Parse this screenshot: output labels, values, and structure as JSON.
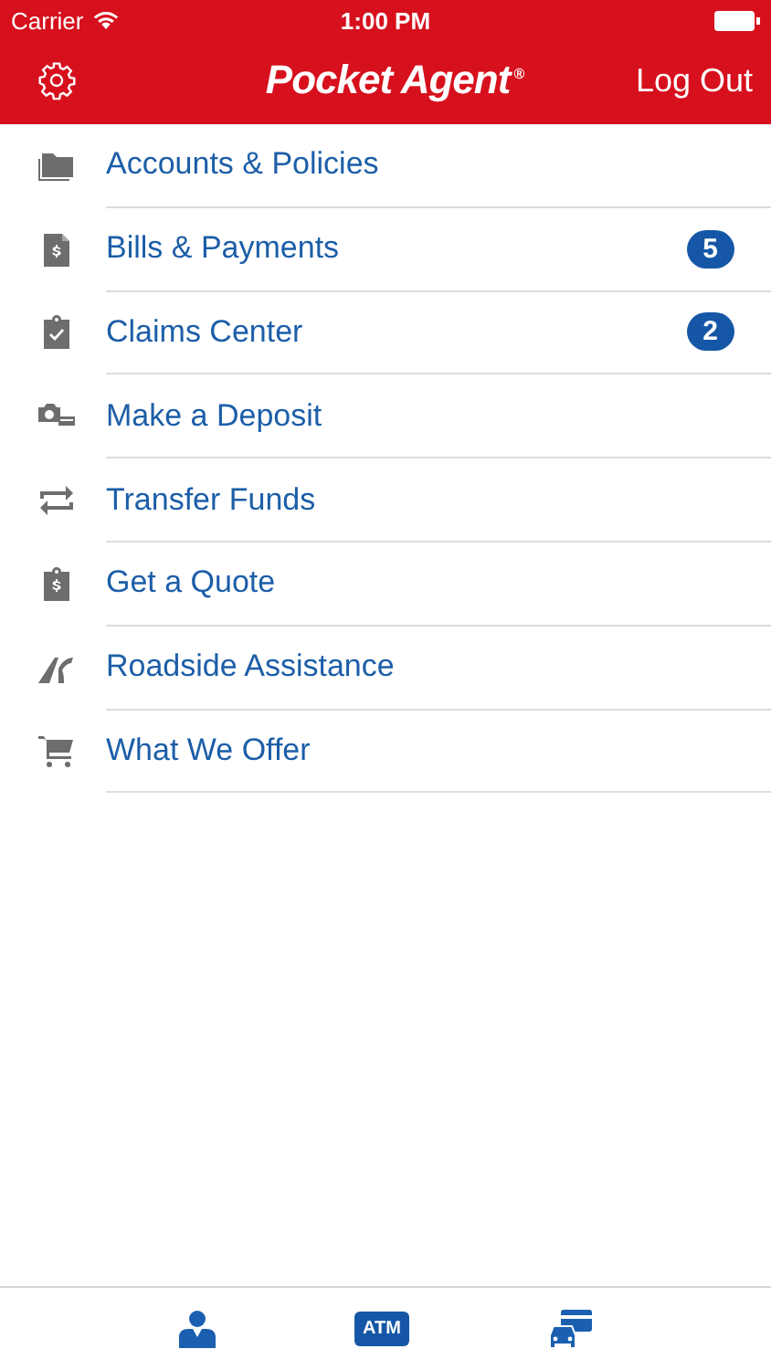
{
  "status_bar": {
    "carrier": "Carrier",
    "time": "1:00 PM"
  },
  "nav_bar": {
    "title": "Pocket Agent",
    "title_mark": "®",
    "right_button": "Log Out"
  },
  "menu": [
    {
      "kind": "folder",
      "label": "Accounts & Policies"
    },
    {
      "kind": "bill",
      "label": "Bills & Payments",
      "badge": "5"
    },
    {
      "kind": "claim",
      "label": "Claims Center",
      "badge": "2"
    },
    {
      "kind": "camera",
      "label": "Make a Deposit"
    },
    {
      "kind": "transfer",
      "label": "Transfer Funds"
    },
    {
      "kind": "quote",
      "label": "Get a Quote"
    },
    {
      "kind": "road",
      "label": "Roadside Assistance"
    },
    {
      "kind": "cart",
      "label": "What We Offer"
    }
  ],
  "tab_bar": [
    {
      "kind": "agent"
    },
    {
      "kind": "atm",
      "label": "ATM"
    },
    {
      "kind": "car-card"
    }
  ]
}
